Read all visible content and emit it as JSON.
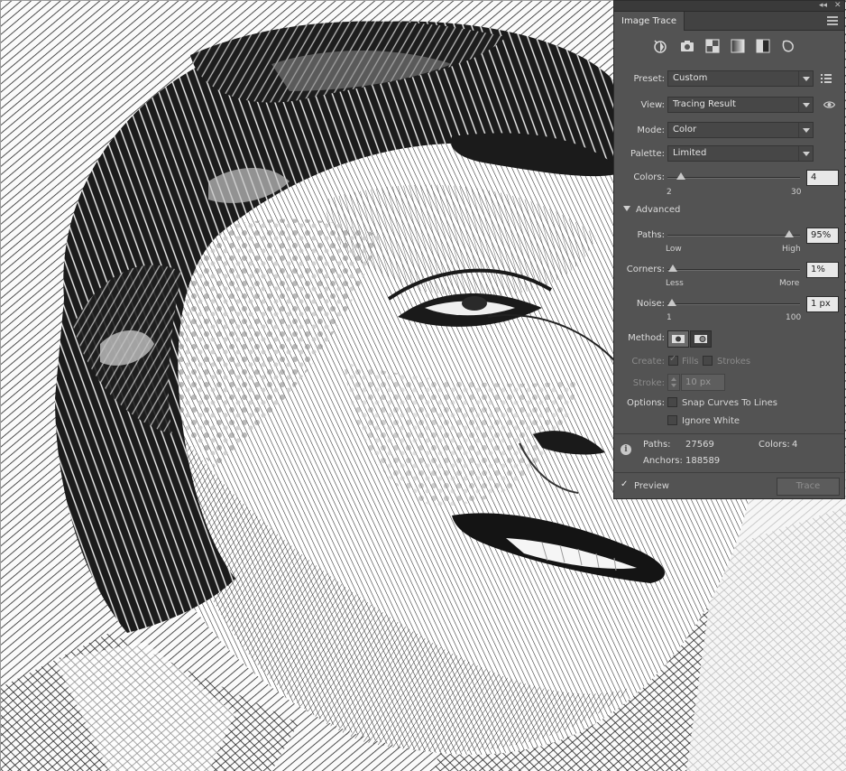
{
  "panel": {
    "collapse_glyph": "◂◂",
    "close_glyph": "✕",
    "tab_title": "Image Trace",
    "preset_icons": [
      "auto-color-icon",
      "high-color-icon",
      "low-color-icon",
      "grayscale-icon",
      "black-and-white-icon",
      "outline-icon"
    ],
    "preset": {
      "label": "Preset:",
      "value": "Custom"
    },
    "view": {
      "label": "View:",
      "value": "Tracing Result"
    },
    "mode": {
      "label": "Mode:",
      "value": "Color"
    },
    "palette": {
      "label": "Palette:",
      "value": "Limited"
    },
    "colors": {
      "label": "Colors:",
      "value": "4",
      "min": "2",
      "max": "30",
      "level": 0.07
    },
    "advanced_label": "Advanced",
    "paths": {
      "label": "Paths:",
      "value": "95%",
      "min": "Low",
      "max": "High",
      "level": 0.95
    },
    "corners": {
      "label": "Corners:",
      "value": "1%",
      "min": "Less",
      "max": "More",
      "level": 0.01
    },
    "noise": {
      "label": "Noise:",
      "value": "1 px",
      "min": "1",
      "max": "100",
      "level": 0.0
    },
    "method_label": "Method:",
    "create_label": "Create:",
    "fills_label": "Fills",
    "strokes_label": "Strokes",
    "stroke_label": "Stroke:",
    "stroke_value": "10 px",
    "options_label": "Options:",
    "snap_label": "Snap Curves To Lines",
    "ignore_white_label": "Ignore White",
    "stats": {
      "paths_label": "Paths:",
      "paths_value": "27569",
      "colors_label": "Colors:",
      "colors_value": "4",
      "anchors_label": "Anchors:",
      "anchors_value": "188589"
    },
    "preview_label": "Preview",
    "trace_label": "Trace"
  },
  "colors": {
    "panel_bg": "#535353",
    "ink": "#1a1a1a",
    "mid_gray": "#8c8c8c",
    "light_gray": "#c4c4c4"
  }
}
